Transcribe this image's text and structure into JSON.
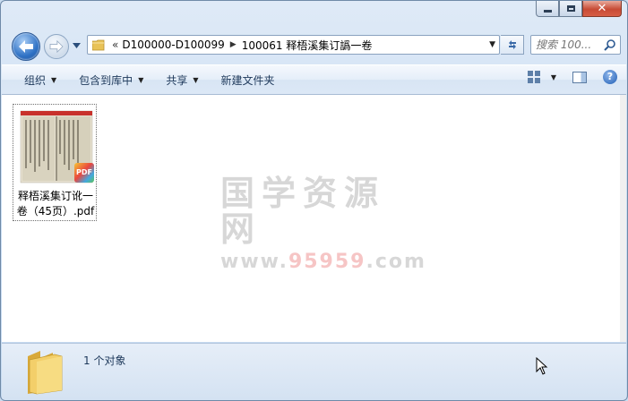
{
  "window": {
    "caption_buttons": {
      "minimize": "minimize",
      "maximize": "maximize",
      "close": "✕"
    }
  },
  "address": {
    "chevron": "«",
    "segments": [
      "D100000-D100099",
      "100061 释梧溪集订譌一卷"
    ],
    "separator": "▶"
  },
  "search": {
    "placeholder": "搜索 100..."
  },
  "toolbar": {
    "organize": "组织",
    "include_in_library": "包含到库中",
    "share": "共享",
    "new_folder": "新建文件夹"
  },
  "file": {
    "name": "释梧溪集订讹一卷（45页）.pdf",
    "badge": "PDF"
  },
  "watermark": {
    "title": "国学资源网",
    "url_prefix": "www.",
    "url_number": "95959",
    "url_suffix": ".com"
  },
  "status": {
    "text": "1 个对象"
  },
  "colors": {
    "accent": "#1e395b",
    "close_button": "#c74b35"
  }
}
